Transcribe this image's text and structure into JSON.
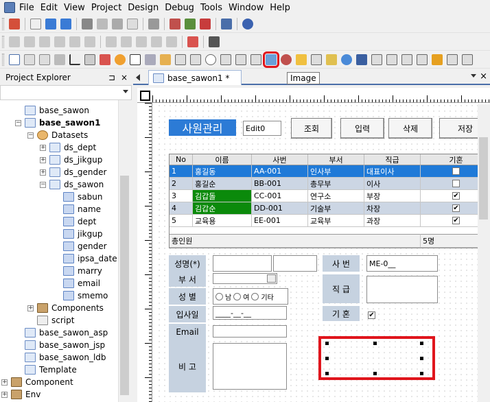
{
  "menu": [
    "File",
    "Edit",
    "View",
    "Project",
    "Design",
    "Debug",
    "Tools",
    "Window",
    "Help"
  ],
  "tooltip": "Image",
  "project_explorer": {
    "title": "Project Explorer",
    "pin": "⊐",
    "close": "×",
    "tree": [
      {
        "label": "base_sawon",
        "level": 1,
        "exp": "",
        "icon": "file"
      },
      {
        "label": "base_sawon1",
        "level": 1,
        "exp": "−",
        "icon": "file",
        "bold": true
      },
      {
        "label": "Datasets",
        "level": 2,
        "exp": "−",
        "icon": "db"
      },
      {
        "label": "ds_dept",
        "level": 3,
        "exp": "+",
        "icon": "file"
      },
      {
        "label": "ds_jikgup",
        "level": 3,
        "exp": "+",
        "icon": "file"
      },
      {
        "label": "ds_gender",
        "level": 3,
        "exp": "+",
        "icon": "file"
      },
      {
        "label": "ds_sawon",
        "level": 3,
        "exp": "−",
        "icon": "file"
      },
      {
        "label": "sabun",
        "level": 4,
        "exp": "",
        "icon": "col"
      },
      {
        "label": "name",
        "level": 4,
        "exp": "",
        "icon": "col"
      },
      {
        "label": "dept",
        "level": 4,
        "exp": "",
        "icon": "col"
      },
      {
        "label": "jikgup",
        "level": 4,
        "exp": "",
        "icon": "col"
      },
      {
        "label": "gender",
        "level": 4,
        "exp": "",
        "icon": "col"
      },
      {
        "label": "ipsa_date",
        "level": 4,
        "exp": "",
        "icon": "col"
      },
      {
        "label": "marry",
        "level": 4,
        "exp": "",
        "icon": "col"
      },
      {
        "label": "email",
        "level": 4,
        "exp": "",
        "icon": "col"
      },
      {
        "label": "smemo",
        "level": 4,
        "exp": "",
        "icon": "col"
      },
      {
        "label": "Components",
        "level": 2,
        "exp": "+",
        "icon": "comp"
      },
      {
        "label": "script",
        "level": 2,
        "exp": "",
        "icon": "script"
      },
      {
        "label": "base_sawon_asp",
        "level": 1,
        "exp": "",
        "icon": "file"
      },
      {
        "label": "base_sawon_jsp",
        "level": 1,
        "exp": "",
        "icon": "file"
      },
      {
        "label": "base_sawon_ldb",
        "level": 1,
        "exp": "",
        "icon": "file"
      },
      {
        "label": "Template",
        "level": 1,
        "exp": "",
        "icon": "file"
      },
      {
        "label": "Component",
        "level": 0,
        "exp": "+",
        "icon": "comp"
      },
      {
        "label": "Env",
        "level": 0,
        "exp": "+",
        "icon": "comp"
      }
    ]
  },
  "doc_tab": {
    "label": "base_sawon1 *",
    "close": "×"
  },
  "form": {
    "title": "사원관리",
    "edit0": "Edit0",
    "buttons": [
      "조회",
      "입력",
      "삭제",
      "저장"
    ],
    "grid": {
      "headers": [
        "No",
        "이름",
        "사번",
        "부서",
        "직급",
        "기혼"
      ],
      "rows": [
        {
          "no": "1",
          "name": "홍길동",
          "sabun": "AA-001",
          "dept": "인사부",
          "jik": "대표이사",
          "marry": true
        },
        {
          "no": "2",
          "name": "홍길순",
          "sabun": "BB-001",
          "dept": "총무부",
          "jik": "이사",
          "marry": false
        },
        {
          "no": "3",
          "name": "김갑돌",
          "sabun": "CC-001",
          "dept": "연구소",
          "jik": "부장",
          "marry": true
        },
        {
          "no": "4",
          "name": "김갑순",
          "sabun": "DD-001",
          "dept": "기술부",
          "jik": "차장",
          "marry": true
        },
        {
          "no": "5",
          "name": "교육용",
          "sabun": "EE-001",
          "dept": "교육부",
          "jik": "과장",
          "marry": true
        }
      ],
      "footer_label": "총인원",
      "footer_count": "5명"
    },
    "labels": {
      "name": "성명(*)",
      "dept": "부 서",
      "gender": "성 별",
      "ipsa": "입사일",
      "email": "Email",
      "bigo": "비 고",
      "sabun": "사 번",
      "jikgup": "직 급",
      "marry": "기 혼"
    },
    "values": {
      "sabun": "ME-0__",
      "ipsa": "____-__-__",
      "gender_options": [
        "남",
        "여",
        "기타"
      ]
    }
  }
}
